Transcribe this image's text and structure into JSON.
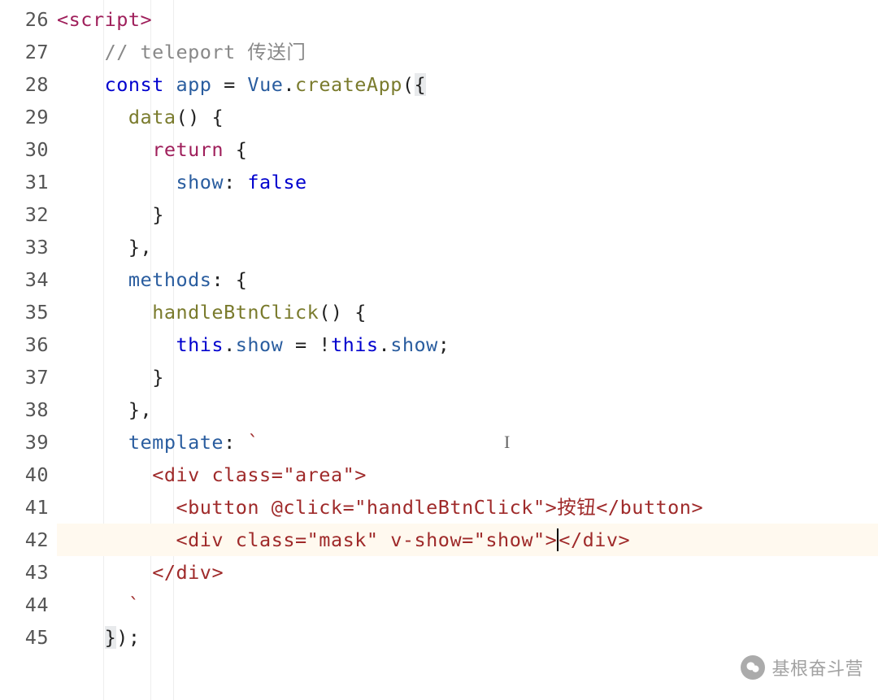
{
  "gutter": {
    "start": 26,
    "end": 45
  },
  "code": {
    "l26": {
      "tag_open": "<",
      "tag_name": "script",
      "tag_close": ">"
    },
    "l27": {
      "slashes": "//",
      "comment": " teleport 传送门"
    },
    "l28": {
      "kw_const": "const",
      "ident_app": "app",
      "eq": "=",
      "ident_vue": "Vue",
      "dot": ".",
      "fn_createApp": "createApp",
      "paren_open": "(",
      "brace_open": "{"
    },
    "l29": {
      "fn_data": "data",
      "parens": "()",
      "brace": "{"
    },
    "l30": {
      "kw_return": "return",
      "brace": "{"
    },
    "l31": {
      "prop_show": "show",
      "colon": ":",
      "kw_false": "false"
    },
    "l32": {
      "brace": "}"
    },
    "l33": {
      "brace_comma": "},"
    },
    "l34": {
      "prop_methods": "methods",
      "colon": ":",
      "brace": "{"
    },
    "l35": {
      "fn_handle": "handleBtnClick",
      "parens": "()",
      "brace": "{"
    },
    "l36": {
      "kw_this1": "this",
      "dot1": ".",
      "prop_show1": "show",
      "eq": "=",
      "bang": "!",
      "kw_this2": "this",
      "dot2": ".",
      "prop_show2": "show",
      "semi": ";"
    },
    "l37": {
      "brace": "}"
    },
    "l38": {
      "brace_comma": "},"
    },
    "l39": {
      "prop_template": "template",
      "colon": ":",
      "backtick": "`"
    },
    "l40": {
      "lt": "<",
      "tag": "div",
      "sp": " ",
      "attr": "class",
      "eq": "=",
      "val": "\"area\"",
      "gt": ">"
    },
    "l41": {
      "lt": "<",
      "tag": "button",
      "sp": " ",
      "attr": "@click",
      "eq": "=",
      "val": "\"handleBtnClick\"",
      "gt": ">",
      "text": "按钮",
      "lt2": "</",
      "tag2": "button",
      "gt2": ">"
    },
    "l42": {
      "lt": "<",
      "tag": "div",
      "sp": " ",
      "attr1": "class",
      "eq1": "=",
      "val1": "\"mask\"",
      "sp2": " ",
      "attr2": "v-show",
      "eq2": "=",
      "val2": "\"show\"",
      "gt": ">",
      "lt2": "</",
      "tag2": "div",
      "gt2": ">"
    },
    "l43": {
      "lt": "</",
      "tag": "div",
      "gt": ">"
    },
    "l44": {
      "backtick": "`"
    },
    "l45": {
      "brace": "}",
      "paren": ")",
      "semi": ";"
    }
  },
  "watermark": {
    "icon_name": "wechat-icon",
    "text": "基根奋斗营"
  }
}
